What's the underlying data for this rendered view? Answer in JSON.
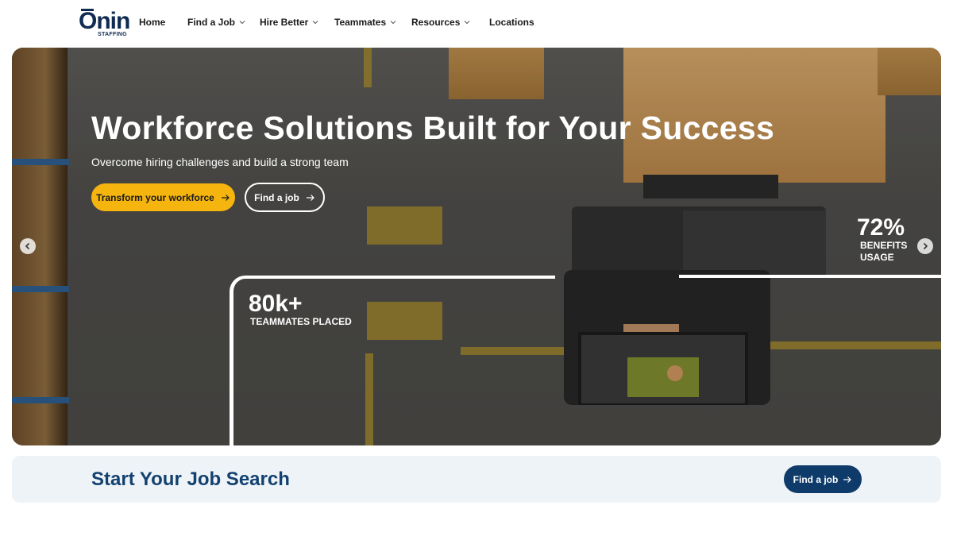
{
  "brand": {
    "name": "Onin",
    "sub": "STAFFING",
    "color": "#0f2b52"
  },
  "nav": {
    "items": [
      {
        "label": "Home",
        "has_dropdown": false
      },
      {
        "label": "Find a Job",
        "has_dropdown": true
      },
      {
        "label": "Hire Better",
        "has_dropdown": true
      },
      {
        "label": "Teammates",
        "has_dropdown": true
      },
      {
        "label": "Resources",
        "has_dropdown": true
      },
      {
        "label": "Locations",
        "has_dropdown": false
      }
    ]
  },
  "hero": {
    "title": "Workforce Solutions Built for Your Success",
    "subtitle": "Overcome hiring challenges and build a strong team",
    "primary_cta": "Transform your workforce",
    "secondary_cta": "Find a job",
    "stats": [
      {
        "value": "80k+",
        "label": "TEAMMATES PLACED"
      },
      {
        "value": "72%",
        "label_line1": "BENEFITS",
        "label_line2": "USAGE"
      }
    ],
    "carousel_prev_icon": "chevron-left-icon",
    "carousel_next_icon": "chevron-right-icon"
  },
  "search_panel": {
    "title": "Start Your Job Search",
    "cta": "Find a job"
  },
  "colors": {
    "accent_yellow": "#f5b50e",
    "navy": "#0e3b6a",
    "heading_blue": "#13416f",
    "panel_bg": "#eef3f8"
  }
}
